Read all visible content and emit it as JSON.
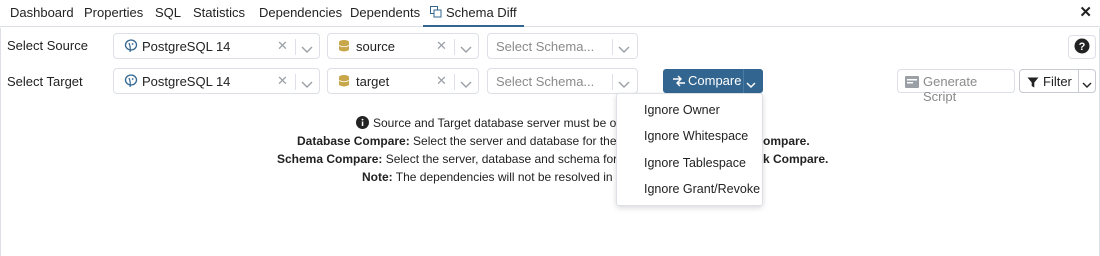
{
  "tabs": [
    "Dashboard",
    "Properties",
    "SQL",
    "Statistics",
    "Dependencies",
    "Dependents",
    "Schema Diff"
  ],
  "active_tab": "Schema Diff",
  "close_label": "✕",
  "labels": {
    "source": "Select Source",
    "target": "Select Target"
  },
  "source": {
    "server": "PostgreSQL 14",
    "database": "source",
    "schema_placeholder": "Select Schema..."
  },
  "target": {
    "server": "PostgreSQL 14",
    "database": "target",
    "schema_placeholder": "Select Schema..."
  },
  "buttons": {
    "compare": "Compare",
    "generate_script": "Generate Script",
    "filter": "Filter",
    "help": "?"
  },
  "compare_menu": [
    "Ignore Owner",
    "Ignore Whitespace",
    "Ignore Tablespace",
    "Ignore Grant/Revoke"
  ],
  "info": {
    "line1": "Source and Target database server must be of",
    "line2_bold": "Database Compare:",
    "line2": " Select the server and database for the so",
    "line2_tail": "ompare.",
    "line3_bold": "Schema Compare:",
    "line3": " Select the server, database and schema for th",
    "line3_tail": "k Compare.",
    "line4_bold": "Note:",
    "line4": " The dependencies will not be resolved in th"
  },
  "colors": {
    "accent": "#326690",
    "border": "#dde0e6",
    "database_icon": "#c8a64a"
  }
}
